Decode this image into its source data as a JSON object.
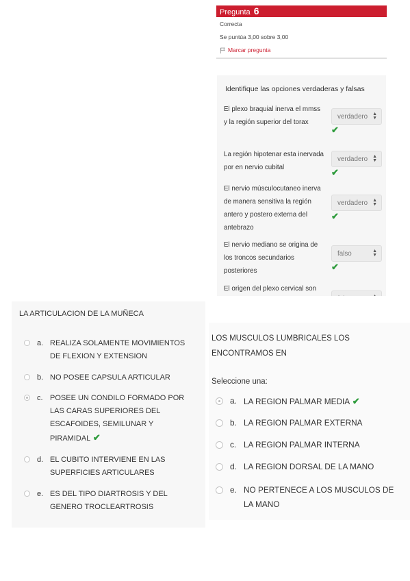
{
  "quiz_info": {
    "label": "Pregunta",
    "number": "6",
    "state": "Correcta",
    "score": "Se puntúa 3,00 sobre 3,00",
    "flag_label": "Marcar pregunta"
  },
  "tf_question": {
    "title": "Identifique las opciones verdaderas y falsas",
    "rows": [
      {
        "text": "El plexo braquial inerva el mmss y la región superior del torax",
        "value": "verdadero"
      },
      {
        "text": "La región hipotenar esta inervada por en nervio cubital",
        "value": "verdadero"
      },
      {
        "text": "El nervio músculocutaneo inerva de manera sensitiva la región antero y postero externa del antebrazo",
        "value": "verdadero"
      },
      {
        "text": "El nervio mediano se origina de los troncos secundarios posteriores",
        "value": "falso"
      },
      {
        "text": "El origen del plexo cervical son las raíces posteriores de los",
        "value": "falso"
      }
    ]
  },
  "q_left": {
    "prompt": "LA ARTICULACION DE LA MUÑECA",
    "options": [
      {
        "letter": "a.",
        "text": "REALIZA SOLAMENTE MOVIMIENTOS DE FLEXION Y EXTENSION"
      },
      {
        "letter": "b.",
        "text": "NO POSEE CAPSULA ARTICULAR"
      },
      {
        "letter": "c.",
        "text": "POSEE UN CONDILO FORMADO POR LAS CARAS SUPERIORES DEL ESCAFOIDES, SEMILUNAR Y PIRAMIDAL"
      },
      {
        "letter": "d.",
        "text": "EL CUBITO INTERVIENE EN LAS SUPERFICIES ARTICULARES"
      },
      {
        "letter": "e.",
        "text": "ES DEL TIPO DIARTROSIS Y DEL GENERO TROCLEARTROSIS"
      }
    ],
    "selected": "c."
  },
  "q_right": {
    "prompt": "LOS MUSCULOS LUMBRICALES LOS ENCONTRAMOS EN",
    "choose_label": "Seleccione una:",
    "options": [
      {
        "letter": "a.",
        "text": "LA REGION PALMAR MEDIA"
      },
      {
        "letter": "b.",
        "text": "LA REGION PALMAR EXTERNA"
      },
      {
        "letter": "c.",
        "text": "LA REGION PALMAR INTERNA"
      },
      {
        "letter": "d.",
        "text": "LA REGION DORSAL DE LA MANO"
      },
      {
        "letter": "e.",
        "text": "NO PERTENECE A LOS MUSCULOS DE LA MANO"
      }
    ],
    "selected": "a."
  },
  "colors": {
    "header_red": "#cc1e2f",
    "check_green": "#2e9b3c"
  },
  "icons": {
    "flag": "flag-icon",
    "check": "check-icon",
    "select_arrows": "sort-arrows-icon"
  }
}
